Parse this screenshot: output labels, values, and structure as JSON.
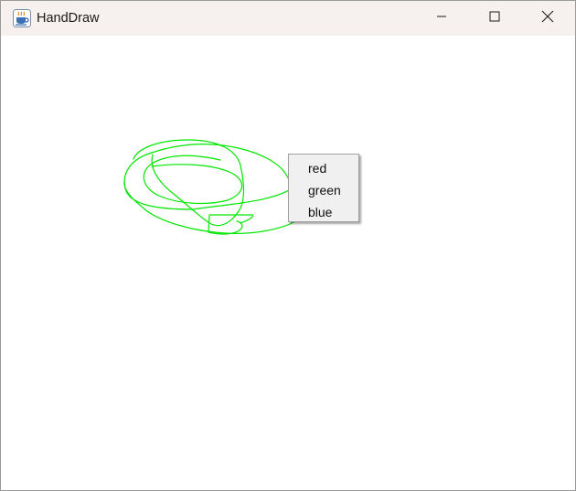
{
  "window": {
    "title": "HandDraw",
    "app_icon": "java-cup-icon",
    "controls": {
      "minimize_icon": "minimize-icon",
      "maximize_icon": "maximize-icon",
      "close_icon": "close-icon"
    }
  },
  "canvas": {
    "stroke_color": "#00e600",
    "background": "#ffffff"
  },
  "popup_menu": {
    "items": [
      {
        "label": "red"
      },
      {
        "label": "green"
      },
      {
        "label": "blue"
      }
    ]
  }
}
